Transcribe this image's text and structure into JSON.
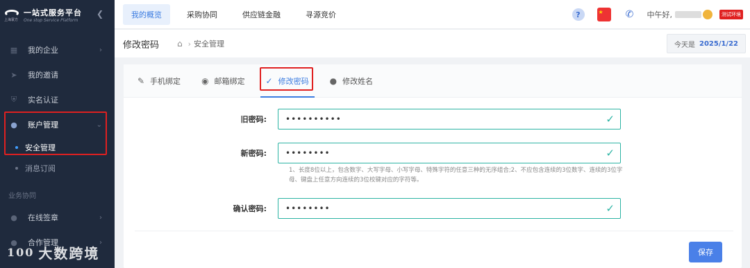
{
  "app": {
    "logo_title": "一站式服务平台",
    "logo_sub": "One stop Service Platform",
    "logo_small": "上海寰方"
  },
  "sidebar": {
    "items": [
      {
        "label": "我的企业",
        "icon": "building-icon",
        "has_arrow": true
      },
      {
        "label": "我的邀请",
        "icon": "send-icon",
        "has_arrow": false
      },
      {
        "label": "实名认证",
        "icon": "shield-icon",
        "has_arrow": false
      },
      {
        "label": "账户管理",
        "icon": "user-icon",
        "has_arrow": true,
        "expanded": true
      }
    ],
    "subitems": [
      {
        "label": "安全管理",
        "active": true
      },
      {
        "label": "消息订阅",
        "active": false
      }
    ],
    "group_label": "业务协同",
    "group_items": [
      {
        "label": "在线签章",
        "icon": "user-icon"
      },
      {
        "label": "合作管理",
        "icon": "user-icon"
      }
    ]
  },
  "watermark": {
    "text": "大数跨境",
    "mark": "100"
  },
  "topbar": {
    "tabs": [
      "我的概览",
      "采购协同",
      "供应链金融",
      "寻源竞价"
    ],
    "active_tab": 0,
    "greeting": "中午好,",
    "env_badge": "测试环境",
    "help_glyph": "?"
  },
  "page_header": {
    "title": "修改密码",
    "breadcrumb_sep": "›",
    "breadcrumb": "安全管理",
    "date_prefix": "今天是",
    "date": "2025/1/22"
  },
  "tabs": [
    {
      "label": "手机绑定",
      "icon": "edit-icon"
    },
    {
      "label": "邮箱绑定",
      "icon": "binoculars-icon"
    },
    {
      "label": "修改密码",
      "icon": "check-icon",
      "active": true
    },
    {
      "label": "修改姓名",
      "icon": "person-icon"
    }
  ],
  "form": {
    "old_password": {
      "label": "旧密码:",
      "value": "••••••••••"
    },
    "new_password": {
      "label": "新密码:",
      "value": "••••••••"
    },
    "hint": "1、长度8位以上，包含数字、大写字母、小写字母、特殊字符的任意三种的无序组合;2、不应包含连续的3位数字、连续的3位字母、键盘上任意方向连续的3位校键对应的字符等。",
    "confirm_password": {
      "label": "确认密码:",
      "value": "••••••••"
    },
    "save_label": "保存"
  },
  "colors": {
    "sidebar_bg": "#1f2a3d",
    "accent": "#3a7be0",
    "valid": "#2bb3a3",
    "highlight_box": "#e02020",
    "save_button": "#4a80e8"
  }
}
